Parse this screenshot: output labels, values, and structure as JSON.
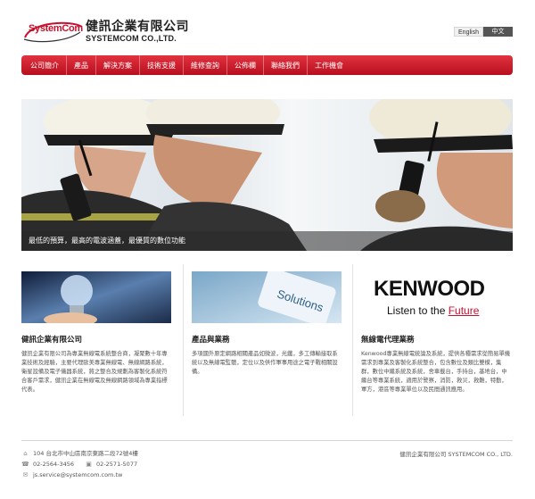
{
  "header": {
    "logo_en": "SystemCom",
    "logo_cn": "健訊企業有限公司",
    "logo_company": "SYSTEMCOM CO.,LTD.",
    "lang_en": "English",
    "lang_zh": "中文"
  },
  "nav": {
    "items": [
      {
        "label": "公司簡介"
      },
      {
        "label": "產品"
      },
      {
        "label": "解決方案"
      },
      {
        "label": "技術支援"
      },
      {
        "label": "維修查詢"
      },
      {
        "label": "公佈欄"
      },
      {
        "label": "聯絡我們"
      },
      {
        "label": "工作機會"
      }
    ]
  },
  "hero": {
    "caption": "最低的預算，最高的電波涵蓋，最優質的數位功能"
  },
  "columns": [
    {
      "title": "健訊企業有限公司",
      "text": "健訊企業有限公司為專業無線電系統整合商，凝聚數十年專業技術及經驗，主要代理歐美專業無線電、無線網路系統，衛星設備及電子儀器系統，將之整合及規劃為客製化系統符合客戶需求，健訊企業在無線電及無線網路領域為專業指標代表。"
    },
    {
      "title": "產品與業務",
      "text": "多項國外原定網路相關產品如微波，光纖，多工傳輸接取系統以及無線電監聽，定位以及供作軍事用途之電子戰相關設備。",
      "thumb_word": "Solutions"
    },
    {
      "title": "無線電代理業務",
      "text": "Kenwood專業無線電統論及系統，提供各種需求從簡易單機需求到專業及客製化系統整合，包含數位及類比雙模，集群，數位中繼系統及系統，舍車載台，手持台，基地台，中繼台等專業系統，適用於警察，消防，救災，救難，特勤，軍方，港區等專業單位以及民間通訊應用。",
      "brand": "KENWOOD",
      "tagline_prefix": "Listen to the ",
      "tagline_accent": "Future"
    }
  ],
  "footer": {
    "address": "104 台北市中山區南京東路二段72號4樓",
    "tel": "02-2564-3456",
    "fax": "02-2571-5077",
    "email": "js.service@systemcom.com.tw",
    "copyright": "健訊企業有限公司 SYSTEMCOM CO., LTD."
  },
  "colors": {
    "brand_red": "#c8102e",
    "nav_red": "#d21c2b"
  }
}
